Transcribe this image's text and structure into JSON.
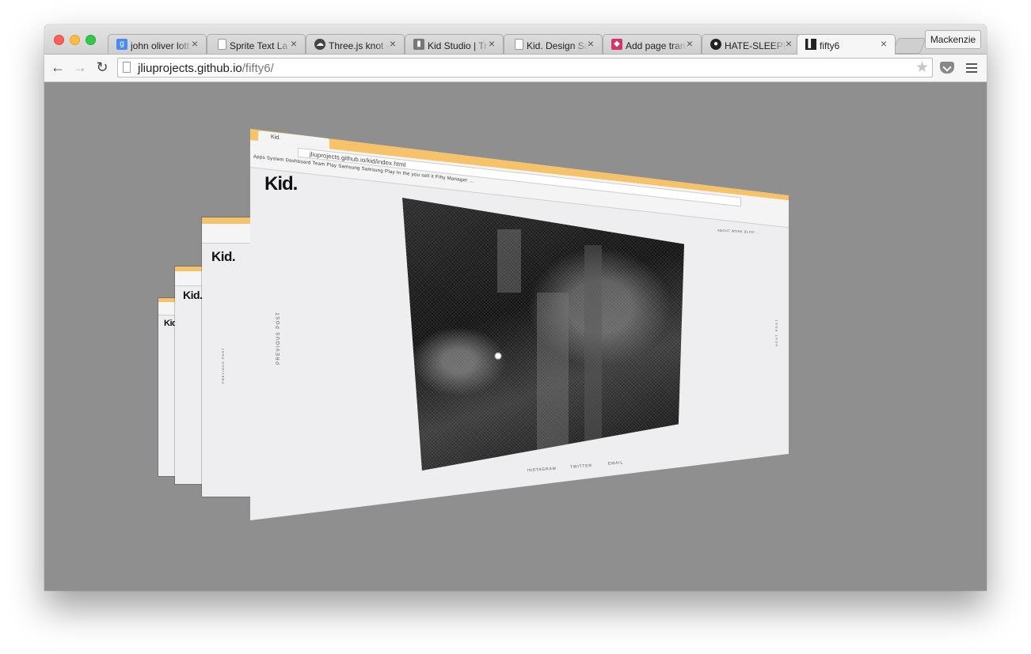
{
  "window": {
    "tabs": [
      {
        "title": "john oliver lott",
        "favicon": "google-icon",
        "favicon_color": "#4a8af4",
        "active": false
      },
      {
        "title": "Sprite Text La",
        "favicon": "page-icon",
        "favicon_color": "#ffffff",
        "active": false
      },
      {
        "title": "Three.js knot -",
        "favicon": "cloud-icon",
        "favicon_color": "#444444",
        "active": false
      },
      {
        "title": "Kid Studio | Tr",
        "favicon": "kid-icon",
        "favicon_color": "#555555",
        "active": false
      },
      {
        "title": "Kid. Design Sa",
        "favicon": "page-icon",
        "favicon_color": "#ffffff",
        "active": false
      },
      {
        "title": "Add page trans",
        "favicon": "pink-icon",
        "favicon_color": "#d6326e",
        "active": false
      },
      {
        "title": "HATE-SLEEPIN",
        "favicon": "github-icon",
        "favicon_color": "#222222",
        "active": false
      },
      {
        "title": "fifty6",
        "favicon": "fifty6-icon",
        "favicon_color": "#222222",
        "active": true
      }
    ],
    "profile_label": "Mackenzie",
    "close_glyph": "×"
  },
  "toolbar": {
    "back": "←",
    "forward": "→",
    "reload": "↻",
    "url_host": "jliuprojects.github.io",
    "url_path": "/fifty6/",
    "star": "★"
  },
  "scene": {
    "mini_tab": "Kid.",
    "mini_url": "jliuprojects.github.io/kid/index.html",
    "mini_bookmarks": "Apps   System Dashboard   Team Play Samsung   Samsung Play   In the you sell it   Fifty Manager   ...",
    "logo": "Kid.",
    "previous_post": "PREVIOUS POST",
    "next_post": "NEXT POST",
    "footer_links": [
      "INSTAGRAM",
      "TWITTER",
      "EMAIL"
    ],
    "nav_links": [
      "ABOUT   WORK   BLOG   ..."
    ],
    "back_logo": "Kid.",
    "back_logo2": "Kid.",
    "back_logo3": "Kid"
  }
}
